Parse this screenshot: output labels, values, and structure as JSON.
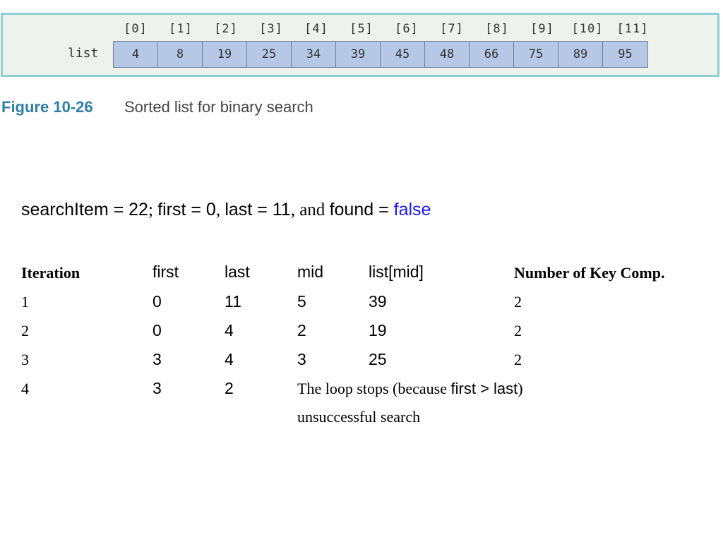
{
  "figure": {
    "indices": [
      "[0]",
      "[1]",
      "[2]",
      "[3]",
      "[4]",
      "[5]",
      "[6]",
      "[7]",
      "[8]",
      "[9]",
      "[10]",
      "[11]"
    ],
    "list_label": "list",
    "values": [
      "4",
      "8",
      "19",
      "25",
      "34",
      "39",
      "45",
      "48",
      "66",
      "75",
      "89",
      "95"
    ],
    "caption_number": "Figure 10-26",
    "caption_text": "Sorted list for binary search"
  },
  "statement": {
    "part1": "searchItem = 22",
    "sep1": "; ",
    "part2": "first = 0",
    "sep2": ", ",
    "part3": "last = 11",
    "sep3": ", and ",
    "part4": "found = ",
    "value_false": "false"
  },
  "table": {
    "headers": [
      "Iteration",
      "first",
      "last",
      "mid",
      "list[mid]",
      "Number of Key Comp."
    ],
    "rows": [
      {
        "iteration": "1",
        "first": "0",
        "last": "11",
        "mid": "5",
        "list_mid": "39",
        "comps": "2"
      },
      {
        "iteration": "2",
        "first": "0",
        "last": "4",
        "mid": "2",
        "list_mid": "19",
        "comps": "2"
      },
      {
        "iteration": "3",
        "first": "3",
        "last": "4",
        "mid": "3",
        "list_mid": "25",
        "comps": "2"
      },
      {
        "iteration": "4",
        "first": "3",
        "last": "2"
      }
    ],
    "stop_note_prefix": "The loop stops (because ",
    "stop_note_condition": "first > last",
    "stop_note_suffix": ")",
    "result_note": "unsuccessful search"
  }
}
